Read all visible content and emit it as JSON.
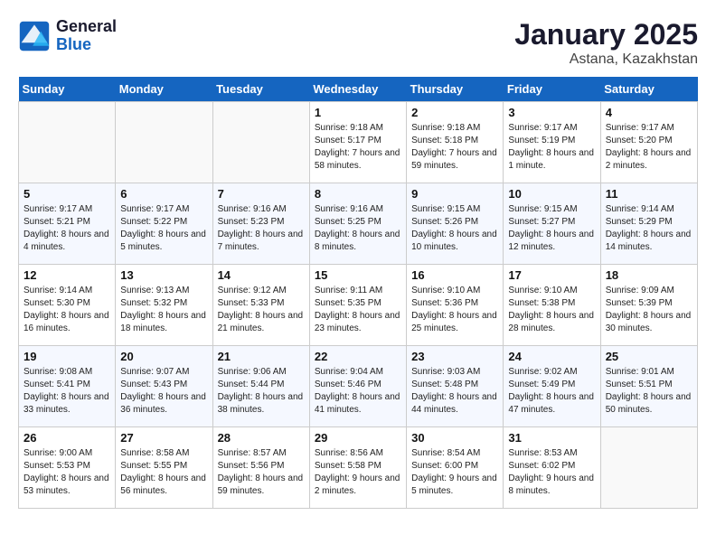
{
  "header": {
    "logo_line1": "General",
    "logo_line2": "Blue",
    "month": "January 2025",
    "location": "Astana, Kazakhstan"
  },
  "weekdays": [
    "Sunday",
    "Monday",
    "Tuesday",
    "Wednesday",
    "Thursday",
    "Friday",
    "Saturday"
  ],
  "weeks": [
    [
      {
        "day": "",
        "sunrise": "",
        "sunset": "",
        "daylight": ""
      },
      {
        "day": "",
        "sunrise": "",
        "sunset": "",
        "daylight": ""
      },
      {
        "day": "",
        "sunrise": "",
        "sunset": "",
        "daylight": ""
      },
      {
        "day": "1",
        "sunrise": "Sunrise: 9:18 AM",
        "sunset": "Sunset: 5:17 PM",
        "daylight": "Daylight: 7 hours and 58 minutes."
      },
      {
        "day": "2",
        "sunrise": "Sunrise: 9:18 AM",
        "sunset": "Sunset: 5:18 PM",
        "daylight": "Daylight: 7 hours and 59 minutes."
      },
      {
        "day": "3",
        "sunrise": "Sunrise: 9:17 AM",
        "sunset": "Sunset: 5:19 PM",
        "daylight": "Daylight: 8 hours and 1 minute."
      },
      {
        "day": "4",
        "sunrise": "Sunrise: 9:17 AM",
        "sunset": "Sunset: 5:20 PM",
        "daylight": "Daylight: 8 hours and 2 minutes."
      }
    ],
    [
      {
        "day": "5",
        "sunrise": "Sunrise: 9:17 AM",
        "sunset": "Sunset: 5:21 PM",
        "daylight": "Daylight: 8 hours and 4 minutes."
      },
      {
        "day": "6",
        "sunrise": "Sunrise: 9:17 AM",
        "sunset": "Sunset: 5:22 PM",
        "daylight": "Daylight: 8 hours and 5 minutes."
      },
      {
        "day": "7",
        "sunrise": "Sunrise: 9:16 AM",
        "sunset": "Sunset: 5:23 PM",
        "daylight": "Daylight: 8 hours and 7 minutes."
      },
      {
        "day": "8",
        "sunrise": "Sunrise: 9:16 AM",
        "sunset": "Sunset: 5:25 PM",
        "daylight": "Daylight: 8 hours and 8 minutes."
      },
      {
        "day": "9",
        "sunrise": "Sunrise: 9:15 AM",
        "sunset": "Sunset: 5:26 PM",
        "daylight": "Daylight: 8 hours and 10 minutes."
      },
      {
        "day": "10",
        "sunrise": "Sunrise: 9:15 AM",
        "sunset": "Sunset: 5:27 PM",
        "daylight": "Daylight: 8 hours and 12 minutes."
      },
      {
        "day": "11",
        "sunrise": "Sunrise: 9:14 AM",
        "sunset": "Sunset: 5:29 PM",
        "daylight": "Daylight: 8 hours and 14 minutes."
      }
    ],
    [
      {
        "day": "12",
        "sunrise": "Sunrise: 9:14 AM",
        "sunset": "Sunset: 5:30 PM",
        "daylight": "Daylight: 8 hours and 16 minutes."
      },
      {
        "day": "13",
        "sunrise": "Sunrise: 9:13 AM",
        "sunset": "Sunset: 5:32 PM",
        "daylight": "Daylight: 8 hours and 18 minutes."
      },
      {
        "day": "14",
        "sunrise": "Sunrise: 9:12 AM",
        "sunset": "Sunset: 5:33 PM",
        "daylight": "Daylight: 8 hours and 21 minutes."
      },
      {
        "day": "15",
        "sunrise": "Sunrise: 9:11 AM",
        "sunset": "Sunset: 5:35 PM",
        "daylight": "Daylight: 8 hours and 23 minutes."
      },
      {
        "day": "16",
        "sunrise": "Sunrise: 9:10 AM",
        "sunset": "Sunset: 5:36 PM",
        "daylight": "Daylight: 8 hours and 25 minutes."
      },
      {
        "day": "17",
        "sunrise": "Sunrise: 9:10 AM",
        "sunset": "Sunset: 5:38 PM",
        "daylight": "Daylight: 8 hours and 28 minutes."
      },
      {
        "day": "18",
        "sunrise": "Sunrise: 9:09 AM",
        "sunset": "Sunset: 5:39 PM",
        "daylight": "Daylight: 8 hours and 30 minutes."
      }
    ],
    [
      {
        "day": "19",
        "sunrise": "Sunrise: 9:08 AM",
        "sunset": "Sunset: 5:41 PM",
        "daylight": "Daylight: 8 hours and 33 minutes."
      },
      {
        "day": "20",
        "sunrise": "Sunrise: 9:07 AM",
        "sunset": "Sunset: 5:43 PM",
        "daylight": "Daylight: 8 hours and 36 minutes."
      },
      {
        "day": "21",
        "sunrise": "Sunrise: 9:06 AM",
        "sunset": "Sunset: 5:44 PM",
        "daylight": "Daylight: 8 hours and 38 minutes."
      },
      {
        "day": "22",
        "sunrise": "Sunrise: 9:04 AM",
        "sunset": "Sunset: 5:46 PM",
        "daylight": "Daylight: 8 hours and 41 minutes."
      },
      {
        "day": "23",
        "sunrise": "Sunrise: 9:03 AM",
        "sunset": "Sunset: 5:48 PM",
        "daylight": "Daylight: 8 hours and 44 minutes."
      },
      {
        "day": "24",
        "sunrise": "Sunrise: 9:02 AM",
        "sunset": "Sunset: 5:49 PM",
        "daylight": "Daylight: 8 hours and 47 minutes."
      },
      {
        "day": "25",
        "sunrise": "Sunrise: 9:01 AM",
        "sunset": "Sunset: 5:51 PM",
        "daylight": "Daylight: 8 hours and 50 minutes."
      }
    ],
    [
      {
        "day": "26",
        "sunrise": "Sunrise: 9:00 AM",
        "sunset": "Sunset: 5:53 PM",
        "daylight": "Daylight: 8 hours and 53 minutes."
      },
      {
        "day": "27",
        "sunrise": "Sunrise: 8:58 AM",
        "sunset": "Sunset: 5:55 PM",
        "daylight": "Daylight: 8 hours and 56 minutes."
      },
      {
        "day": "28",
        "sunrise": "Sunrise: 8:57 AM",
        "sunset": "Sunset: 5:56 PM",
        "daylight": "Daylight: 8 hours and 59 minutes."
      },
      {
        "day": "29",
        "sunrise": "Sunrise: 8:56 AM",
        "sunset": "Sunset: 5:58 PM",
        "daylight": "Daylight: 9 hours and 2 minutes."
      },
      {
        "day": "30",
        "sunrise": "Sunrise: 8:54 AM",
        "sunset": "Sunset: 6:00 PM",
        "daylight": "Daylight: 9 hours and 5 minutes."
      },
      {
        "day": "31",
        "sunrise": "Sunrise: 8:53 AM",
        "sunset": "Sunset: 6:02 PM",
        "daylight": "Daylight: 9 hours and 8 minutes."
      },
      {
        "day": "",
        "sunrise": "",
        "sunset": "",
        "daylight": ""
      }
    ]
  ]
}
